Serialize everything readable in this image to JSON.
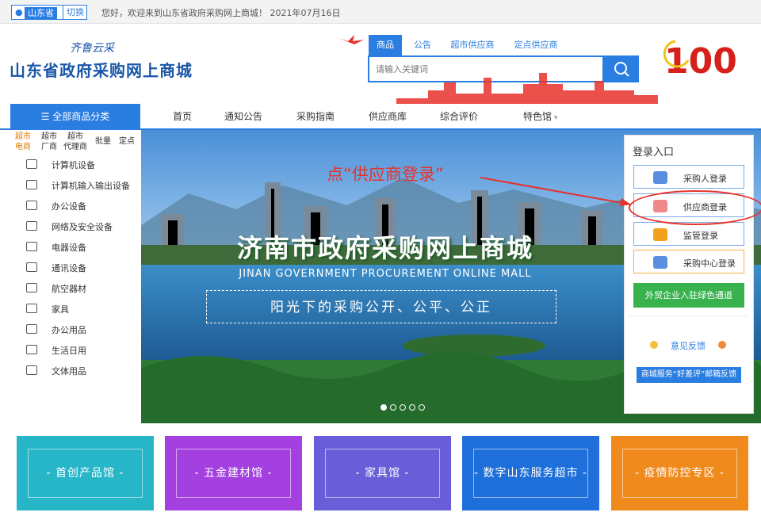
{
  "topbar": {
    "province": "山东省",
    "switch_label": "切换",
    "welcome": "您好，欢迎来到山东省政府采购网上商城！ 2021年07月16日"
  },
  "header": {
    "slogan": "齐鲁云采",
    "site_title": "山东省政府采购网上商城",
    "search_tabs": [
      "商品",
      "公告",
      "超市供应商",
      "定点供应商"
    ],
    "search_placeholder": "请输入关键词"
  },
  "nav": {
    "category_button": "全部商品分类",
    "items": [
      "首页",
      "通知公告",
      "采购指南",
      "供应商库",
      "综合评价",
      "特色馆"
    ]
  },
  "sidebar": {
    "subtabs": [
      "超市\n电商",
      "超市\n厂商",
      "超市\n代理商",
      "批量",
      "定点"
    ],
    "categories": [
      "计算机设备",
      "计算机输入输出设备",
      "办公设备",
      "网络及安全设备",
      "电器设备",
      "通讯设备",
      "航空器材",
      "家具",
      "办公用品",
      "生活日用",
      "文体用品"
    ]
  },
  "banner": {
    "annotation": "点“供应商登录”",
    "title": "济南市政府采购网上商城",
    "subtitle": "JINAN GOVERNMENT PROCUREMENT ONLINE MALL",
    "slogan": "阳光下的采购公开、公平、公正"
  },
  "login": {
    "title": "登录入口",
    "buttons": [
      "采购人登录",
      "供应商登录",
      "监管登录",
      "采购中心登录"
    ],
    "foreign_button": "外贸企业入驻绿色通道",
    "feedback": "意见反馈",
    "mail_button": "商城服务“好差评”邮箱反馈"
  },
  "tiles": [
    {
      "label": "- 首创产品馆 -",
      "color": "#27b5c8"
    },
    {
      "label": "- 五金建材馆 -",
      "color": "#a43fe0"
    },
    {
      "label": "- 家具馆 -",
      "color": "#6a5ed8"
    },
    {
      "label": "- 数字山东服务超市 -",
      "color": "#1e6fd9"
    },
    {
      "label": "- 疫情防控专区 -",
      "color": "#f08a1c"
    }
  ],
  "colors": {
    "accent": "#2a7de1",
    "annotation": "#e8312b",
    "green": "#37b24d"
  }
}
